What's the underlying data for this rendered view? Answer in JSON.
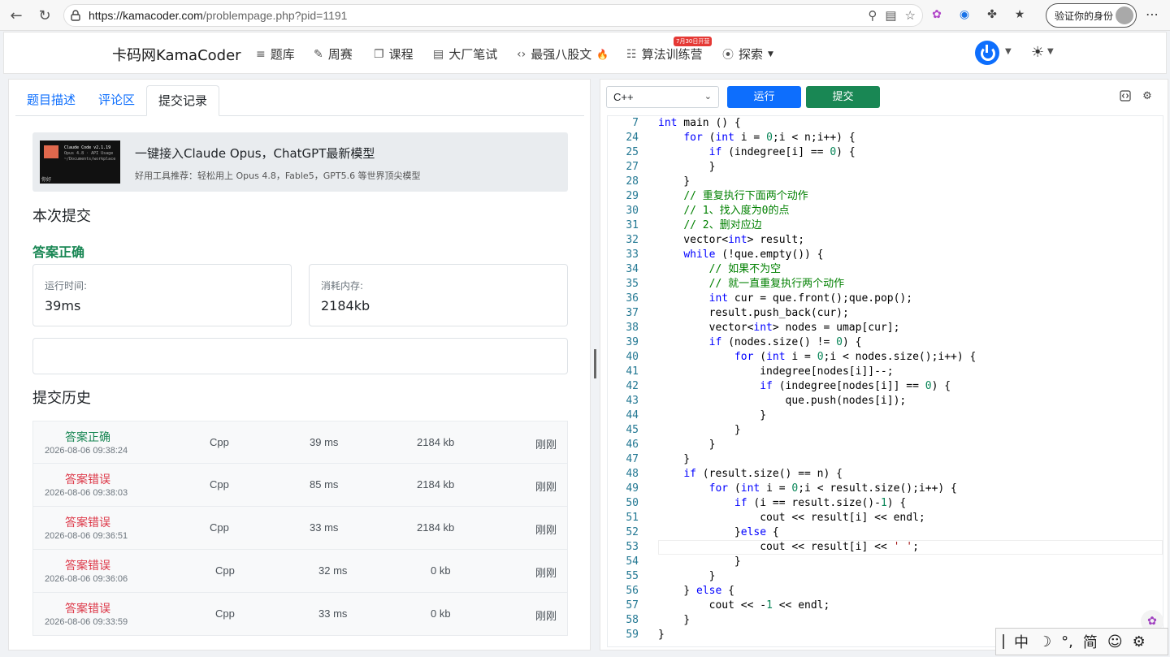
{
  "browser": {
    "url_host": "https://kamacoder.com",
    "url_path": "/problempage.php?pid=1191",
    "verify_label": "验证你的身份"
  },
  "header": {
    "brand": "卡码网KamaCoder",
    "nav": [
      {
        "label": "题库",
        "icon": "list-icon"
      },
      {
        "label": "周赛",
        "icon": "pencil-icon"
      },
      {
        "label": "课程",
        "icon": "copy-icon"
      },
      {
        "label": "大厂笔试",
        "icon": "doc-icon"
      },
      {
        "label": "最强八股文",
        "icon": "code-icon"
      },
      {
        "label": "算法训练营",
        "icon": "calendar-icon"
      },
      {
        "label": "探索",
        "icon": "compass-icon"
      }
    ],
    "hot_badge": "7月30日开营",
    "fire": "🔥"
  },
  "left": {
    "tabs": [
      "题目描述",
      "评论区",
      "提交记录"
    ],
    "promo": {
      "img_line1": "Claude Code v2.1.19",
      "img_line2": "Opus 4.8 · API Usage",
      "img_line3": "~/Documents/workplace",
      "img_line4": "你好",
      "title": "一键接入Claude Opus，ChatGPT最新模型",
      "subtitle": "好用工具推荐：轻松用上 Opus 4.8，Fable5，GPT5.6 等世界顶尖模型"
    },
    "current_title": "本次提交",
    "result": "答案正确",
    "runtime_label": "运行时间:",
    "runtime_value": "39ms",
    "memory_label": "消耗内存:",
    "memory_value": "2184kb",
    "history_title": "提交历史",
    "history": [
      {
        "status": "答案正确",
        "ok": true,
        "time": "2026-08-06 09:38:24",
        "lang": "Cpp",
        "runtime": "39 ms",
        "memory": "2184 kb",
        "when": "刚刚"
      },
      {
        "status": "答案错误",
        "ok": false,
        "time": "2026-08-06 09:38:03",
        "lang": "Cpp",
        "runtime": "85 ms",
        "memory": "2184 kb",
        "when": "刚刚"
      },
      {
        "status": "答案错误",
        "ok": false,
        "time": "2026-08-06 09:36:51",
        "lang": "Cpp",
        "runtime": "33 ms",
        "memory": "2184 kb",
        "when": "刚刚"
      },
      {
        "status": "答案错误",
        "ok": false,
        "time": "2026-08-06 09:36:06",
        "lang": "Cpp",
        "runtime": "32 ms",
        "memory": "0 kb",
        "when": "刚刚"
      },
      {
        "status": "答案错误",
        "ok": false,
        "time": "2026-08-06 09:33:59",
        "lang": "Cpp",
        "runtime": "33 ms",
        "memory": "0 kb",
        "when": "刚刚"
      }
    ]
  },
  "editor": {
    "language": "C++",
    "run_label": "运行",
    "submit_label": "提交",
    "lines": [
      {
        "n": "7",
        "code": "int main () {"
      },
      {
        "n": "24",
        "code": "    for (int i = 0;i < n;i++) {"
      },
      {
        "n": "25",
        "code": "        if (indegree[i] == 0) {"
      },
      {
        "n": "27",
        "code": "        }"
      },
      {
        "n": "28",
        "code": "    }"
      },
      {
        "n": "29",
        "code": "    // 重复执行下面两个动作"
      },
      {
        "n": "30",
        "code": "    // 1、找入度为0的点"
      },
      {
        "n": "31",
        "code": "    // 2、删对应边"
      },
      {
        "n": "32",
        "code": "    vector<int> result;"
      },
      {
        "n": "33",
        "code": "    while (!que.empty()) {"
      },
      {
        "n": "34",
        "code": "        // 如果不为空"
      },
      {
        "n": "35",
        "code": "        // 就一直重复执行两个动作"
      },
      {
        "n": "36",
        "code": "        int cur = que.front();que.pop();"
      },
      {
        "n": "37",
        "code": "        result.push_back(cur);"
      },
      {
        "n": "38",
        "code": "        vector<int> nodes = umap[cur];"
      },
      {
        "n": "39",
        "code": "        if (nodes.size() != 0) {"
      },
      {
        "n": "40",
        "code": "            for (int i = 0;i < nodes.size();i++) {"
      },
      {
        "n": "41",
        "code": "                indegree[nodes[i]]--;"
      },
      {
        "n": "42",
        "code": "                if (indegree[nodes[i]] == 0) {"
      },
      {
        "n": "43",
        "code": "                    que.push(nodes[i]);"
      },
      {
        "n": "44",
        "code": "                }"
      },
      {
        "n": "45",
        "code": "            }"
      },
      {
        "n": "46",
        "code": "        }"
      },
      {
        "n": "47",
        "code": "    }"
      },
      {
        "n": "48",
        "code": "    if (result.size() == n) {"
      },
      {
        "n": "49",
        "code": "        for (int i = 0;i < result.size();i++) {"
      },
      {
        "n": "50",
        "code": "            if (i == result.size()-1) {"
      },
      {
        "n": "51",
        "code": "                cout << result[i] << endl;"
      },
      {
        "n": "52",
        "code": "            }else {"
      },
      {
        "n": "53",
        "code": "                cout << result[i] << ' ';"
      },
      {
        "n": "54",
        "code": "            }"
      },
      {
        "n": "55",
        "code": "        }"
      },
      {
        "n": "56",
        "code": "    } else {"
      },
      {
        "n": "57",
        "code": "        cout << -1 << endl;"
      },
      {
        "n": "58",
        "code": "    }"
      },
      {
        "n": "59",
        "code": "}"
      }
    ],
    "highlight_line": "53"
  },
  "ime": {
    "mode": "中",
    "punct": "°,",
    "script": "简"
  }
}
